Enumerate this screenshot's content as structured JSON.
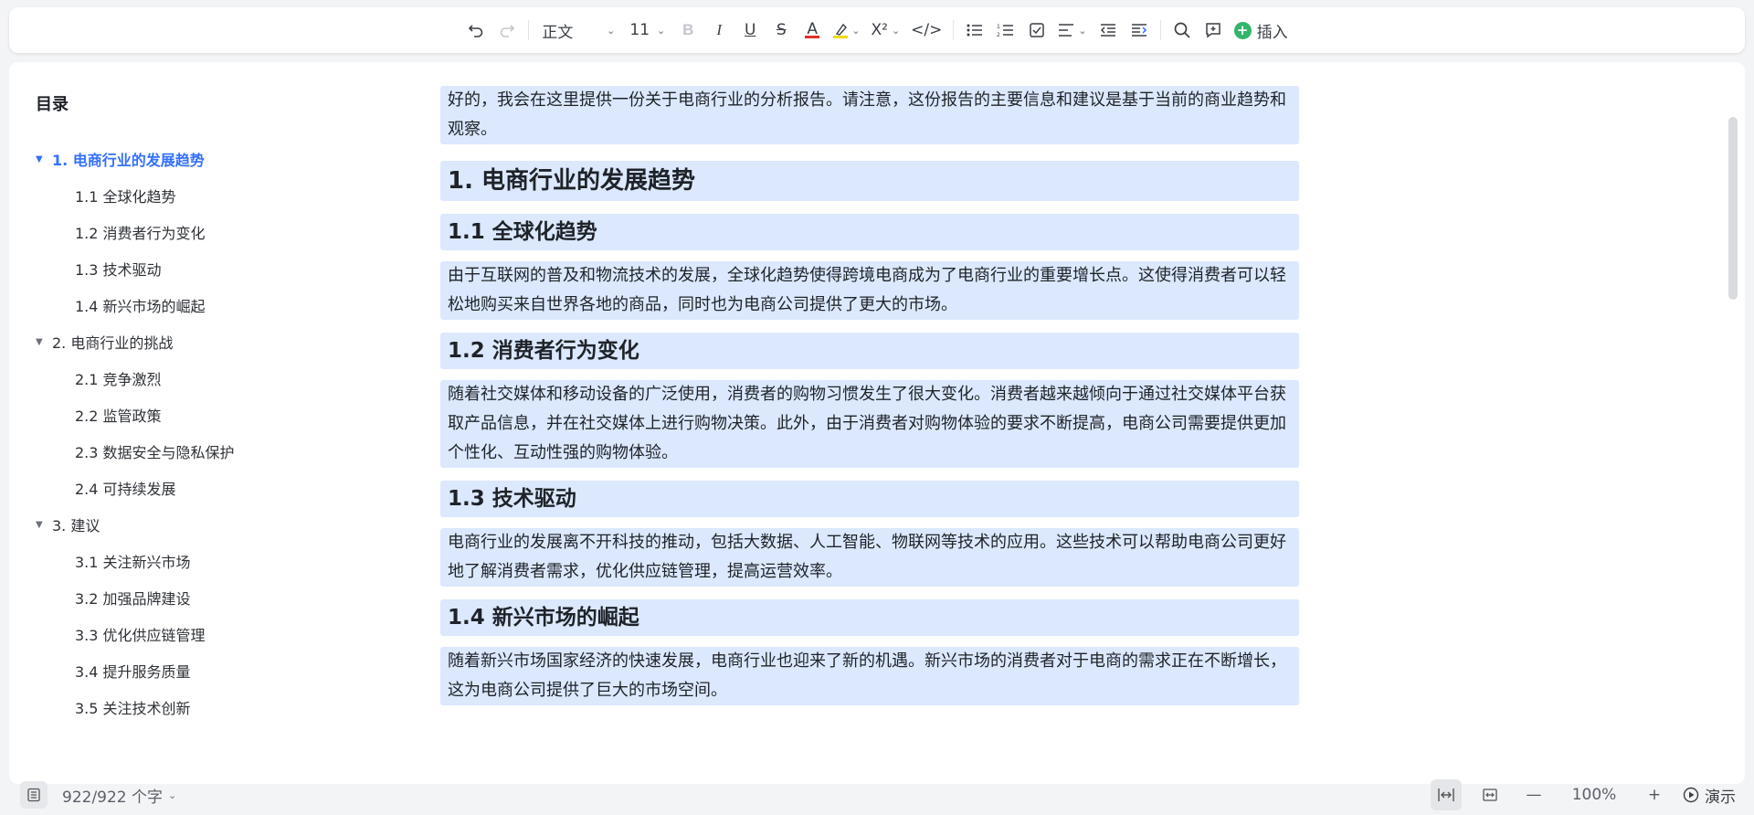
{
  "toolbar": {
    "style_label": "正文",
    "font_size": "11",
    "superscript_label": "X²",
    "insert_label": "插入",
    "text_color": "#e02f2f",
    "highlight_color": "#f5d90a"
  },
  "toc": {
    "title": "目录",
    "items": [
      {
        "label": "1. 电商行业的发展趋势",
        "level": 1,
        "active": true
      },
      {
        "label": "1.1 全球化趋势",
        "level": 2
      },
      {
        "label": "1.2 消费者行为变化",
        "level": 2
      },
      {
        "label": "1.3 技术驱动",
        "level": 2
      },
      {
        "label": "1.4 新兴市场的崛起",
        "level": 2
      },
      {
        "label": "2. 电商行业的挑战",
        "level": 1
      },
      {
        "label": "2.1 竞争激烈",
        "level": 2
      },
      {
        "label": "2.2 监管政策",
        "level": 2
      },
      {
        "label": "2.3 数据安全与隐私保护",
        "level": 2
      },
      {
        "label": "2.4 可持续发展",
        "level": 2
      },
      {
        "label": "3. 建议",
        "level": 1
      },
      {
        "label": "3.1 关注新兴市场",
        "level": 2
      },
      {
        "label": "3.2 加强品牌建设",
        "level": 2
      },
      {
        "label": "3.3 优化供应链管理",
        "level": 2
      },
      {
        "label": "3.4 提升服务质量",
        "level": 2
      },
      {
        "label": "3.5 关注技术创新",
        "level": 2
      }
    ]
  },
  "content": {
    "intro": "好的，我会在这里提供一份关于电商行业的分析报告。请注意，这份报告的主要信息和建议是基于当前的商业趋势和观察。",
    "h1": "1. 电商行业的发展趋势",
    "sections": [
      {
        "heading": "1.1 全球化趋势",
        "text": "由于互联网的普及和物流技术的发展，全球化趋势使得跨境电商成为了电商行业的重要增长点。这使得消费者可以轻松地购买来自世界各地的商品，同时也为电商公司提供了更大的市场。"
      },
      {
        "heading": "1.2 消费者行为变化",
        "text": "随着社交媒体和移动设备的广泛使用，消费者的购物习惯发生了很大变化。消费者越来越倾向于通过社交媒体平台获取产品信息，并在社交媒体上进行购物决策。此外，由于消费者对购物体验的要求不断提高，电商公司需要提供更加个性化、互动性强的购物体验。"
      },
      {
        "heading": "1.3 技术驱动",
        "text": "电商行业的发展离不开科技的推动，包括大数据、人工智能、物联网等技术的应用。这些技术可以帮助电商公司更好地了解消费者需求，优化供应链管理，提高运营效率。"
      },
      {
        "heading": "1.4 新兴市场的崛起",
        "text": "随着新兴市场国家经济的快速发展，电商行业也迎来了新的机遇。新兴市场的消费者对于电商的需求正在不断增长，这为电商公司提供了巨大的市场空间。"
      }
    ]
  },
  "status": {
    "word_count": "922/922 个字",
    "zoom": "100%",
    "present_label": "演示"
  }
}
